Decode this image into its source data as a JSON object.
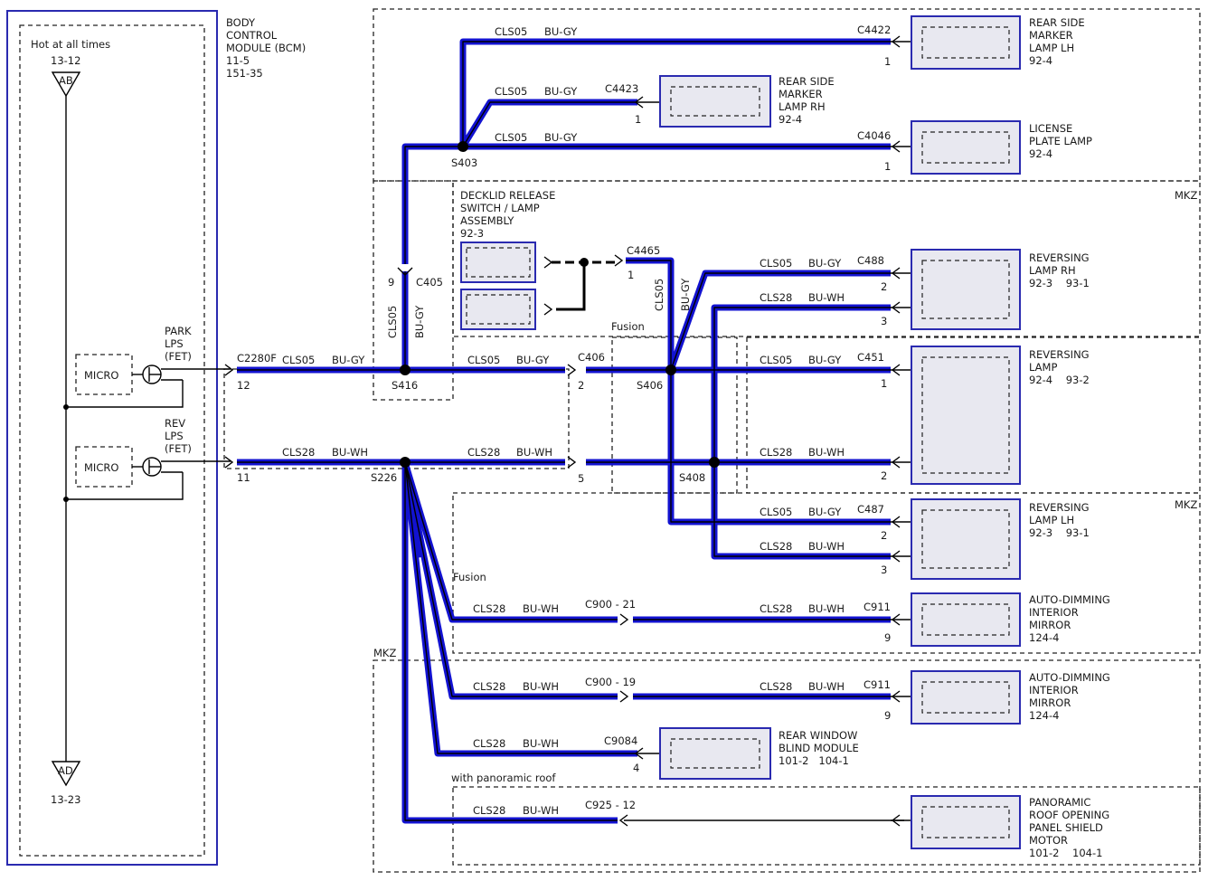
{
  "bcm": {
    "title_l1": "BODY",
    "title_l2": "CONTROL",
    "title_l3": "MODULE (BCM)",
    "ref1": "11-5",
    "ref2": "151-35",
    "hot_label": "Hot at all times",
    "top_ref": "13-12",
    "top_conn": "AB",
    "bottom_conn": "AD",
    "bottom_ref": "13-23",
    "park_l1": "PARK",
    "park_l2": "LPS",
    "park_l3": "(FET)",
    "rev_l1": "REV",
    "rev_l2": "LPS",
    "rev_l3": "(FET)",
    "micro1": "MICRO",
    "micro2": "MICRO",
    "connector": "C2280F",
    "pin_park": "12",
    "pin_rev": "11"
  },
  "wires": {
    "cls05": "CLS05",
    "cls28": "CLS28",
    "bugy": "BU-GY",
    "buwh": "BU-WH"
  },
  "splices": {
    "s403": "S403",
    "s416": "S416",
    "s406": "S406",
    "s408": "S408",
    "s226": "S226"
  },
  "connectors": {
    "c405": "C405",
    "c405_pin": "9",
    "c406": "C406",
    "c406_pin_a": "2",
    "c406_pin_b": "5",
    "c4465": "C4465",
    "c4465_pin": "1",
    "c4422": "C4422",
    "c4423": "C4423",
    "c4046": "C4046",
    "c488": "C488",
    "c451": "C451",
    "c487": "C487",
    "c900_21": "C900 - 21",
    "c900_19": "C900 - 19",
    "c911a": "C911",
    "c911b": "C911",
    "c9084": "C9084",
    "c925": "C925 - 12",
    "pin1": "1",
    "pin2": "2",
    "pin3": "3",
    "pin4": "4",
    "pin9": "9"
  },
  "components": {
    "rsm_lh": [
      "REAR SIDE",
      "MARKER",
      "LAMP LH",
      "92-4"
    ],
    "rsm_rh": [
      "REAR SIDE",
      "MARKER",
      "LAMP RH",
      "92-4"
    ],
    "license": [
      "LICENSE",
      "PLATE LAMP",
      "92-4"
    ],
    "decklid": [
      "DECKLID RELEASE",
      "SWITCH / LAMP",
      "ASSEMBLY",
      "92-3"
    ],
    "rev_rh": [
      "REVERSING",
      "LAMP RH",
      "92-3    93-1"
    ],
    "rev": [
      "REVERSING",
      "LAMP",
      "92-4    93-2"
    ],
    "rev_lh": [
      "REVERSING",
      "LAMP LH",
      "92-3    93-1"
    ],
    "mirror1": [
      "AUTO-DIMMING",
      "INTERIOR",
      "MIRROR",
      "124-4"
    ],
    "mirror2": [
      "AUTO-DIMMING",
      "INTERIOR",
      "MIRROR",
      "124-4"
    ],
    "blind": [
      "REAR WINDOW",
      "BLIND MODULE",
      "101-2   104-1"
    ],
    "roof": [
      "PANORAMIC",
      "ROOF OPENING",
      "PANEL SHIELD",
      "MOTOR",
      "101-2    104-1"
    ]
  },
  "regions": {
    "mkz1": "MKZ",
    "mkz2": "MKZ",
    "mkz3": "MKZ",
    "fusion1": "Fusion",
    "fusion2": "Fusion",
    "pano": "with panoramic roof"
  }
}
